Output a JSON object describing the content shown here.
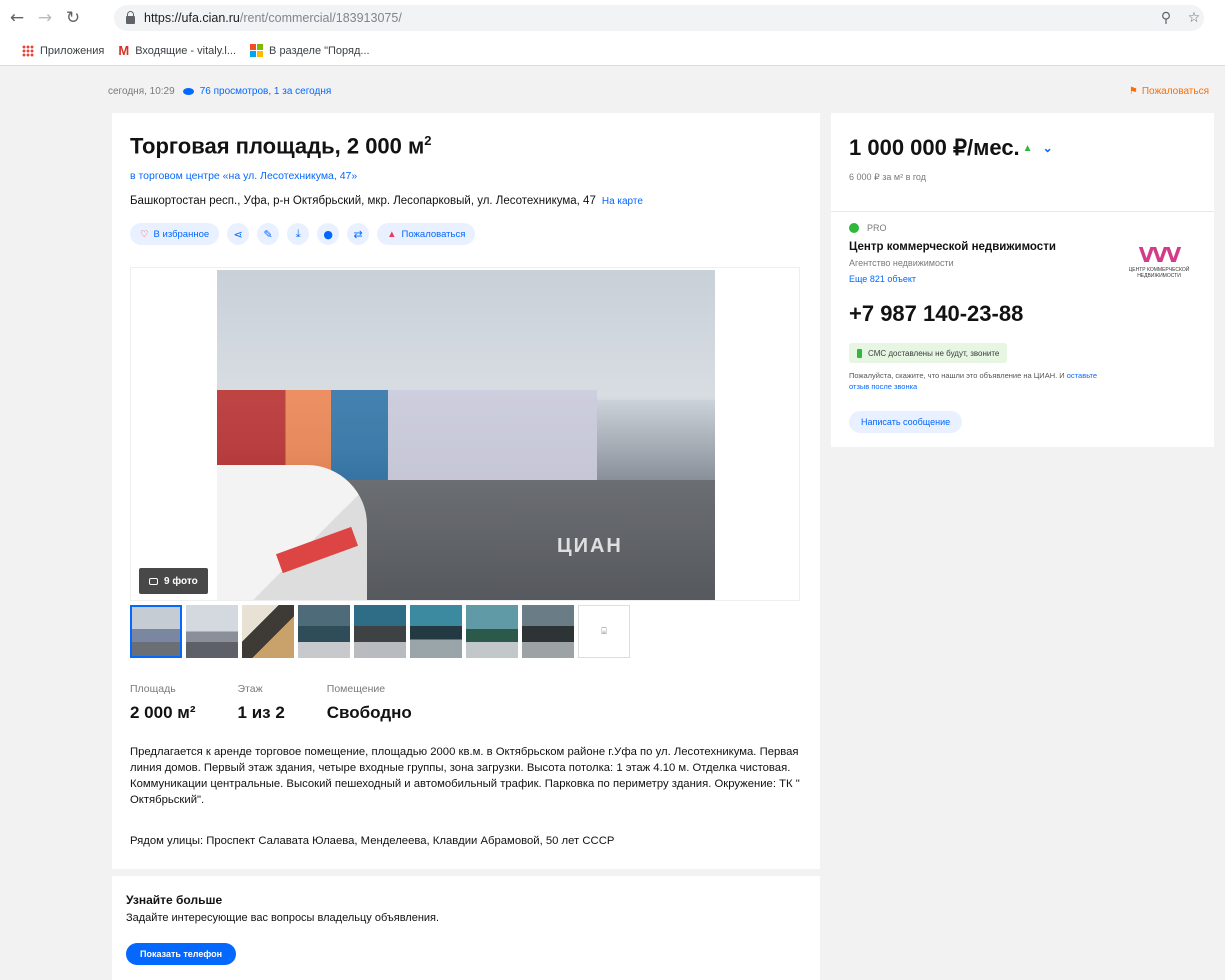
{
  "browser": {
    "url_host": "https://ufa.cian.ru",
    "url_path": "/rent/commercial/183913075/",
    "bookmarks": [
      "Приложения",
      "Входящие - vitaly.l...",
      "В разделе \"Поряд..."
    ]
  },
  "meta": {
    "date": "сегодня, 10:29",
    "views": "76 просмотров, 1 за сегодня",
    "complain": "Пожаловаться"
  },
  "listing": {
    "title": "Торговая площадь, 2 000 м",
    "title_sup": "2",
    "subtitle_link": "в торговом центре «на ул. Лесотехникума, 47»",
    "address": "Башкортостан респ., Уфа, р-н Октябрьский, мкр. Лесопарковый, ул. Лесотехникума, 47",
    "map_link": "На карте",
    "favorite_label": "В избранное",
    "complain_label": "Пожаловаться",
    "photo_count": "9 фото",
    "watermark": "ЦИАН",
    "facts": [
      {
        "label": "Площадь",
        "value": "2 000 м²"
      },
      {
        "label": "Этаж",
        "value": "1 из 2"
      },
      {
        "label": "Помещение",
        "value": "Свободно"
      }
    ],
    "description": "Предлагается к аренде торговое помещение, площадью 2000 кв.м. в Октябрьском районе г.Уфа по ул. Лесотехникума. Первая линия домов. Первый этаж здания, четыре входные группы, зона загрузки. Высота потолка: 1 этаж 4.10 м. Отделка чистовая. Коммуникации центральные. Высокий пешеходный и автомобильный трафик. Парковка по периметру здания. Окружение: ТК \" Октябрьский\".",
    "nearby_streets": "Рядом улицы: Проспект Салавата Юлаева, Менделеева, Клавдии Абрамовой, 50 лет СССР"
  },
  "learn_more": {
    "title": "Узнайте больше",
    "text": "Задайте интересующие вас вопросы владельцу объявления.",
    "button": "Показать телефон"
  },
  "sidebar": {
    "price": "1 000 000 ₽/мес.",
    "price_per": "6 000 ₽ за м² в год",
    "pro": "PRO",
    "agency_name": "Центр коммерческой недвижимости",
    "agency_type": "Агентство недвижимости",
    "agency_more": "Еще 821 объект",
    "logo_text": "ЦЕНТР КОММЕРЧЕСКОЙ НЕДВИЖИМОСТИ",
    "phone": "+7 987 140-23-88",
    "sms_badge": "СМС доставлены не будут, звоните",
    "note_text": "Пожалуйста, скажите, что нашли это объявление на ЦИАН. И",
    "note_link": "оставьте отзыв после звонка",
    "message_button": "Написать сообщение"
  },
  "colors": {
    "accent": "#0468ff",
    "warning": "#ff6d00",
    "success": "#2fb83a"
  }
}
